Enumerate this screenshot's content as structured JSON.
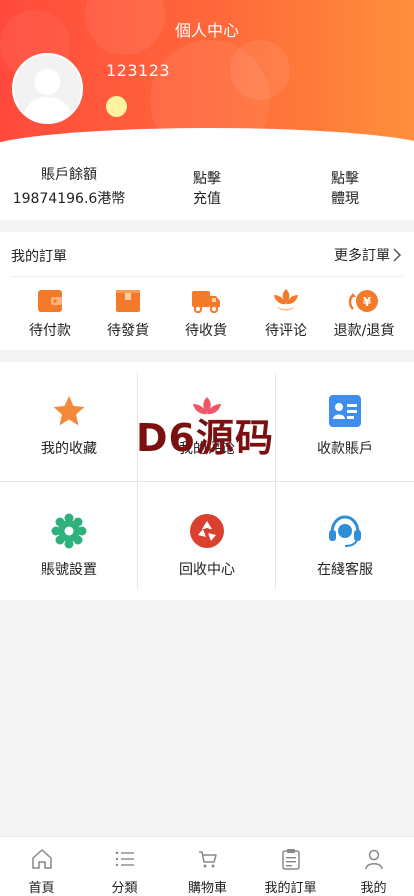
{
  "header": {
    "title": "個人中心",
    "username": "123123"
  },
  "balance": {
    "label": "賬戶餘額",
    "amount": "19874196.6港幣",
    "recharge_line1": "點擊",
    "recharge_line2": "充值",
    "withdraw_line1": "點擊",
    "withdraw_line2": "體現"
  },
  "orders": {
    "title": "我的訂單",
    "more": "更多訂單",
    "items": [
      {
        "label": "待付款",
        "icon": "wallet-icon"
      },
      {
        "label": "待發貨",
        "icon": "package-icon"
      },
      {
        "label": "待收貨",
        "icon": "truck-icon"
      },
      {
        "label": "待评论",
        "icon": "flower-icon"
      },
      {
        "label": "退款/退貨",
        "icon": "refund-icon"
      }
    ]
  },
  "services": [
    {
      "label": "我的收藏",
      "icon": "star-icon",
      "color": "#f4883a"
    },
    {
      "label": "我的评论",
      "icon": "flower-icon",
      "color": "#f0566a"
    },
    {
      "label": "收款賬戶",
      "icon": "id-card-icon",
      "color": "#3d8ef0"
    },
    {
      "label": "賬號設置",
      "icon": "gear-icon",
      "color": "#2fb07c"
    },
    {
      "label": "回收中心",
      "icon": "recycle-icon",
      "color": "#d9402e"
    },
    {
      "label": "在綫客服",
      "icon": "headset-icon",
      "color": "#2f8ed6"
    }
  ],
  "watermark": "D6源码",
  "tabbar": [
    {
      "label": "首頁",
      "icon": "home-icon"
    },
    {
      "label": "分類",
      "icon": "list-icon"
    },
    {
      "label": "購物車",
      "icon": "cart-icon"
    },
    {
      "label": "我的訂單",
      "icon": "clipboard-icon"
    },
    {
      "label": "我的",
      "icon": "user-icon"
    }
  ],
  "colors": {
    "header_start": "#ff4a3d",
    "header_end": "#ff8f3a",
    "order_icon": "#f47a2a"
  }
}
